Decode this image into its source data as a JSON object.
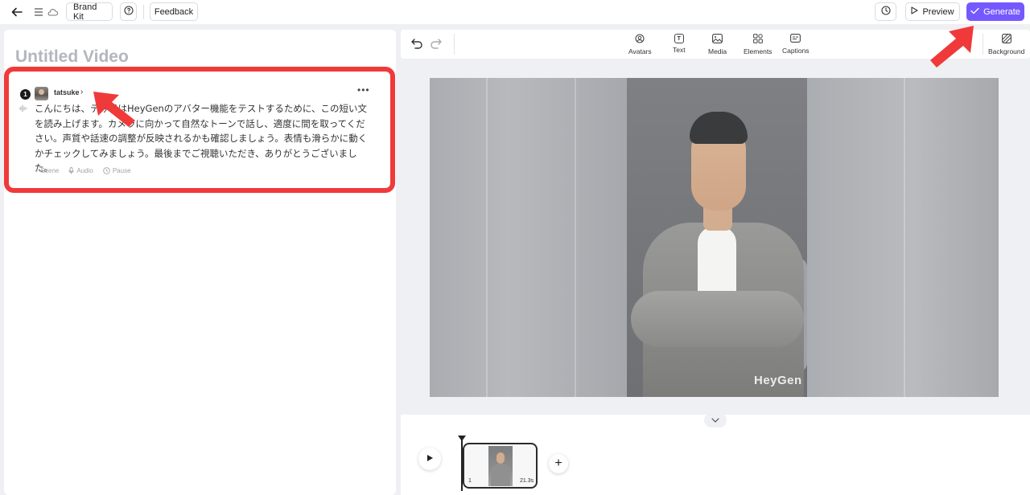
{
  "topbar": {
    "brand_kit": "Brand Kit",
    "feedback": "Feedback",
    "preview": "Preview",
    "generate": "Generate"
  },
  "editor": {
    "video_title": "Untitled Video"
  },
  "scene": {
    "number": "1",
    "avatar_name": "tatsuke",
    "script_text": "こんにちは、テ今日はHeyGenのアバター機能をテストするために、この短い文を読み上げます。カメラに向かって自然なトーンで話し、適度に間を取ってください。声質や話速の調整が反映されるかも確認しましょう。表情も滑らかに動くかチェックしてみましょう。最後までご視聴いただき、ありがとうございました。",
    "actions": [
      "Scene",
      "Audio",
      "Pause"
    ]
  },
  "toolbar": {
    "tools": [
      "Avatars",
      "Text",
      "Media",
      "Elements",
      "Captions"
    ],
    "background": "Background"
  },
  "canvas": {
    "watermark": "HeyGen"
  },
  "timeline": {
    "clip_number": "1",
    "clip_duration": "21.3s"
  },
  "colors": {
    "accent": "#7559ff",
    "highlight": "#f03a3a"
  }
}
